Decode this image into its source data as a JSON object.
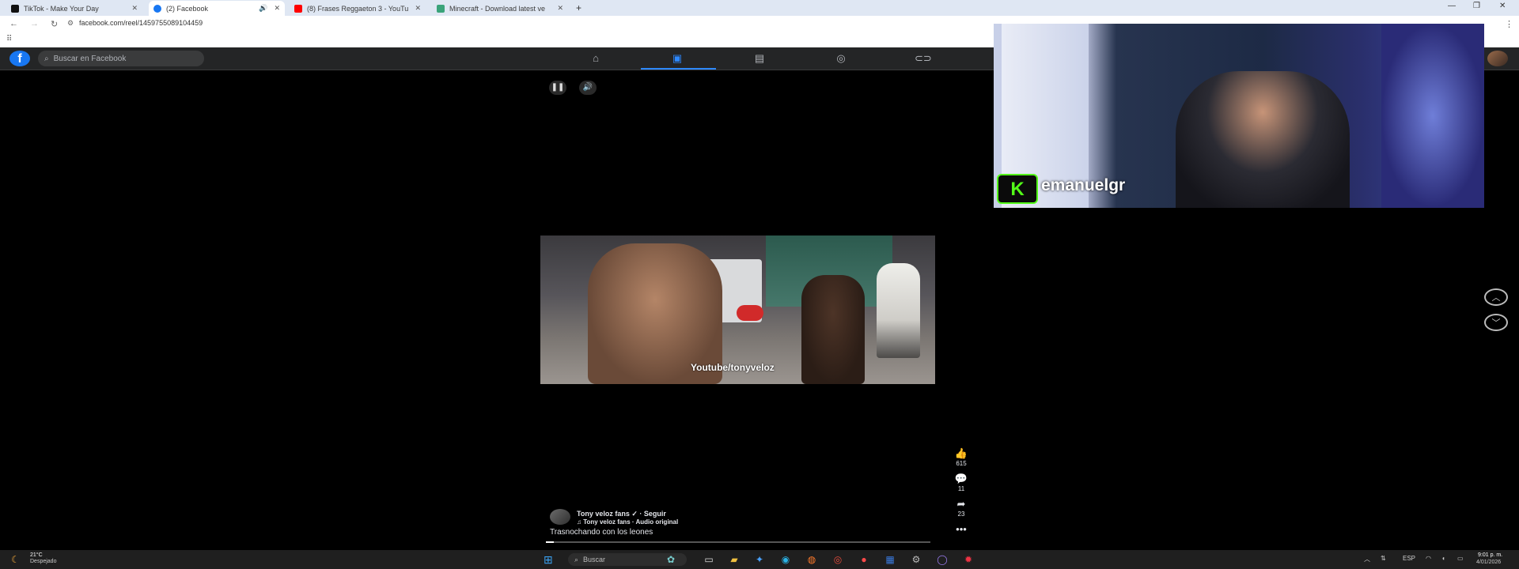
{
  "browser": {
    "tabs": [
      {
        "title": "TikTok - Make Your Day",
        "favicon_color": "#111111"
      },
      {
        "title": "(2) Facebook",
        "favicon_color": "#1877f2"
      },
      {
        "title": "(8) Frases Reggaeton 3 - YouTu",
        "favicon_color": "#ff0000"
      },
      {
        "title": "Minecraft - Download latest ve",
        "favicon_color": "#3aa37a"
      }
    ],
    "new_tab_label": "+",
    "url": "facebook.com/reel/1459755089104459"
  },
  "facebook": {
    "logo": "f",
    "search_placeholder": "Buscar en Facebook",
    "nav_icons": [
      "home-icon",
      "reels-icon",
      "marketplace-icon",
      "groups-icon",
      "gaming-icon"
    ],
    "active_nav": "reels-icon"
  },
  "reel": {
    "video_watermark": "Youtube/tonyveloz",
    "likes": "615",
    "comments": "11",
    "shares": "23",
    "author": "Tony veloz fans ✓ · Seguir",
    "audio": "♫ Tony veloz fans · Audio original",
    "caption": "Trasnochando con los leones",
    "progress_fraction": 0.02
  },
  "stream_overlay": {
    "platform_logo": "K",
    "streamer_name": "emanuelgr",
    "accent_color": "#53fc18"
  },
  "taskbar": {
    "temperature": "21°C",
    "weather": "Despejado",
    "search_placeholder": "Buscar",
    "language": "ESP",
    "time": "9:01 p. m.",
    "date": "4/01/2026"
  }
}
